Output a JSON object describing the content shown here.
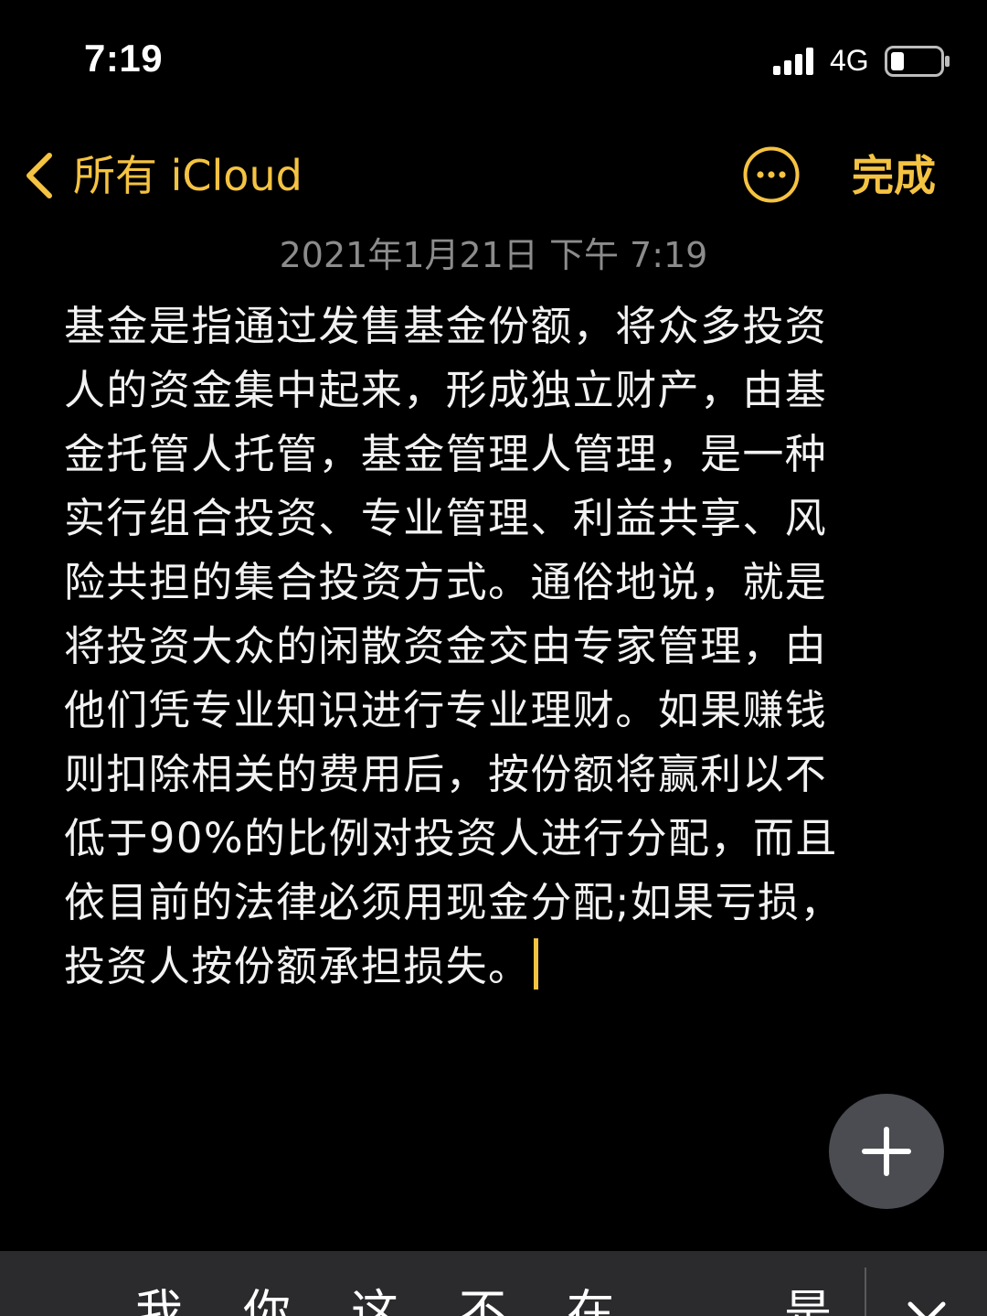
{
  "status_bar": {
    "time": "7:19",
    "network": "4G",
    "signal_icon": "signal-bars-icon",
    "battery_icon": "battery-low-icon"
  },
  "nav": {
    "back_label": "所有 iCloud",
    "back_icon": "chevron-left-icon",
    "more_icon": "ellipsis-circle-icon",
    "done_label": "完成",
    "accent_color": "#f5c342"
  },
  "note": {
    "date": "2021年1月21日 下午 7:19",
    "lines": [
      "基金是指通过发售基金份额，将众多投资",
      "人的资金集中起来，形成独立财产，由基",
      "金托管人托管，基金管理人管理，是一种",
      "实行组合投资、专业管理、利益共享、风",
      "险共担的集合投资方式。通俗地说，就是",
      "将投资大众的闲散资金交由专家管理，由",
      "他们凭专业知识进行专业理财。如果赚钱",
      "则扣除相关的费用后，按份额将赢利以不",
      "低于90%的比例对投资人进行分配，而且",
      "依目前的法律必须用现金分配;如果亏损，",
      "投资人按份额承担损失。"
    ]
  },
  "compose": {
    "icon": "plus-icon"
  },
  "keyboard": {
    "suggestions": [
      "我",
      "你",
      "这",
      "不",
      "在",
      "是"
    ],
    "close_icon": "close-icon",
    "background_color": "#2b2b2d"
  }
}
